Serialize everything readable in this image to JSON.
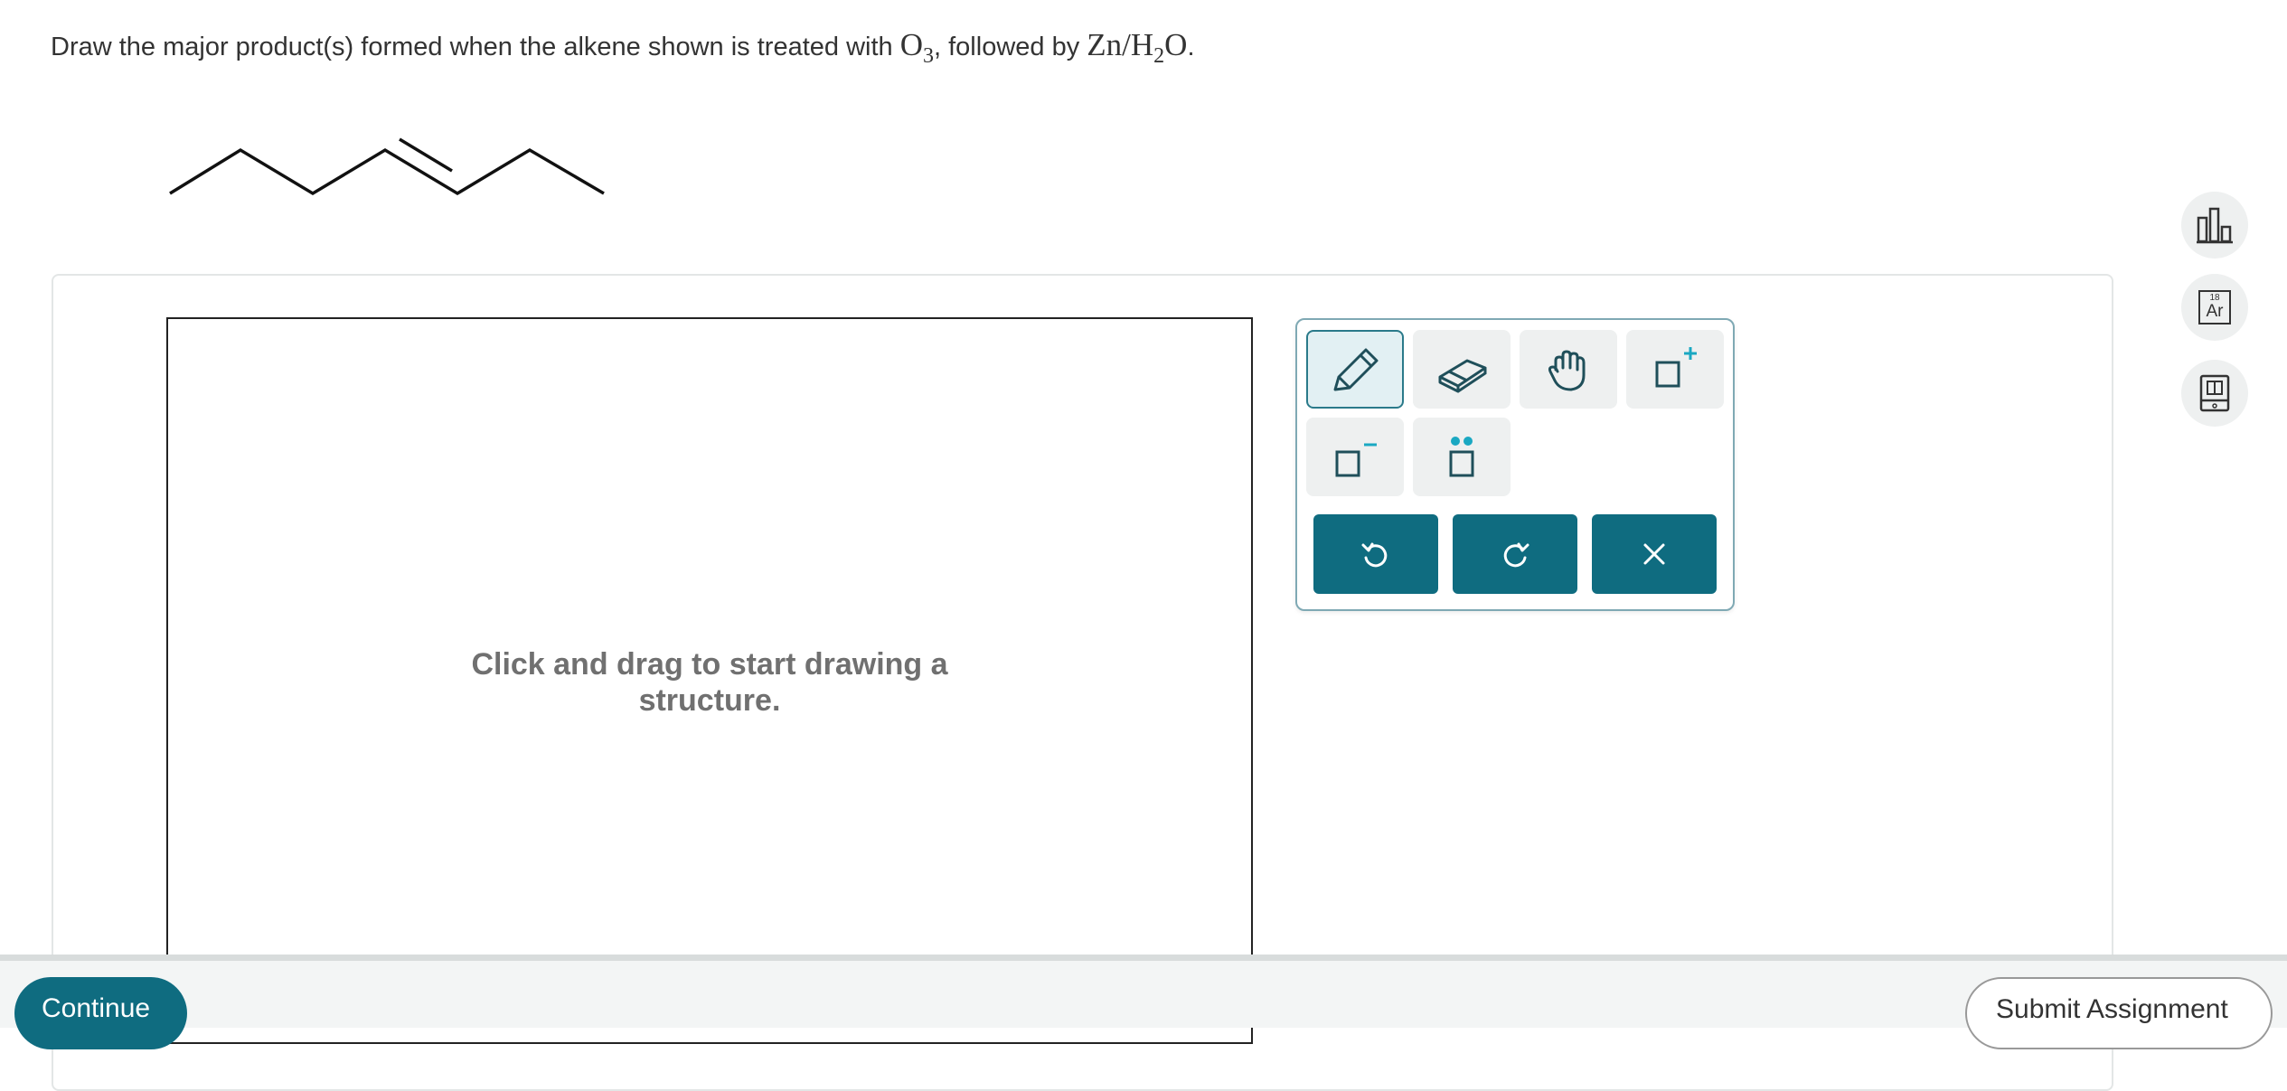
{
  "question": {
    "prefix": "Draw the major product(s) formed when the alkene shown is treated with ",
    "reagent1": "O",
    "reagent1_sub": "3",
    "comma": ",",
    "middle": " followed by ",
    "reagent2_a": "Zn/H",
    "reagent2_sub": "2",
    "reagent2_b": "O",
    "period": "."
  },
  "canvas": {
    "hint_line1": "Click and drag to start drawing a",
    "hint_line2": "structure."
  },
  "toolbox": {
    "tools": [
      {
        "name": "pencil-tool",
        "icon": "pencil-icon"
      },
      {
        "name": "eraser-tool",
        "icon": "eraser-icon"
      },
      {
        "name": "hand-tool",
        "icon": "hand-icon"
      },
      {
        "name": "positive-charge-tool",
        "icon": "square-plus-icon"
      },
      {
        "name": "negative-charge-tool",
        "icon": "square-minus-icon"
      },
      {
        "name": "lone-pair-tool",
        "icon": "lone-pair-icon"
      }
    ],
    "actions": [
      "undo",
      "redo",
      "clear"
    ]
  },
  "side_tools": {
    "periodic_label_num": "18",
    "periodic_label_sym": "Ar"
  },
  "footer": {
    "continue_label": "Continue",
    "submit_label": "Submit Assignment"
  },
  "colors": {
    "accent": "#0f6c80",
    "teal_icon": "#1aa8c2",
    "hint_gray": "#707070"
  }
}
